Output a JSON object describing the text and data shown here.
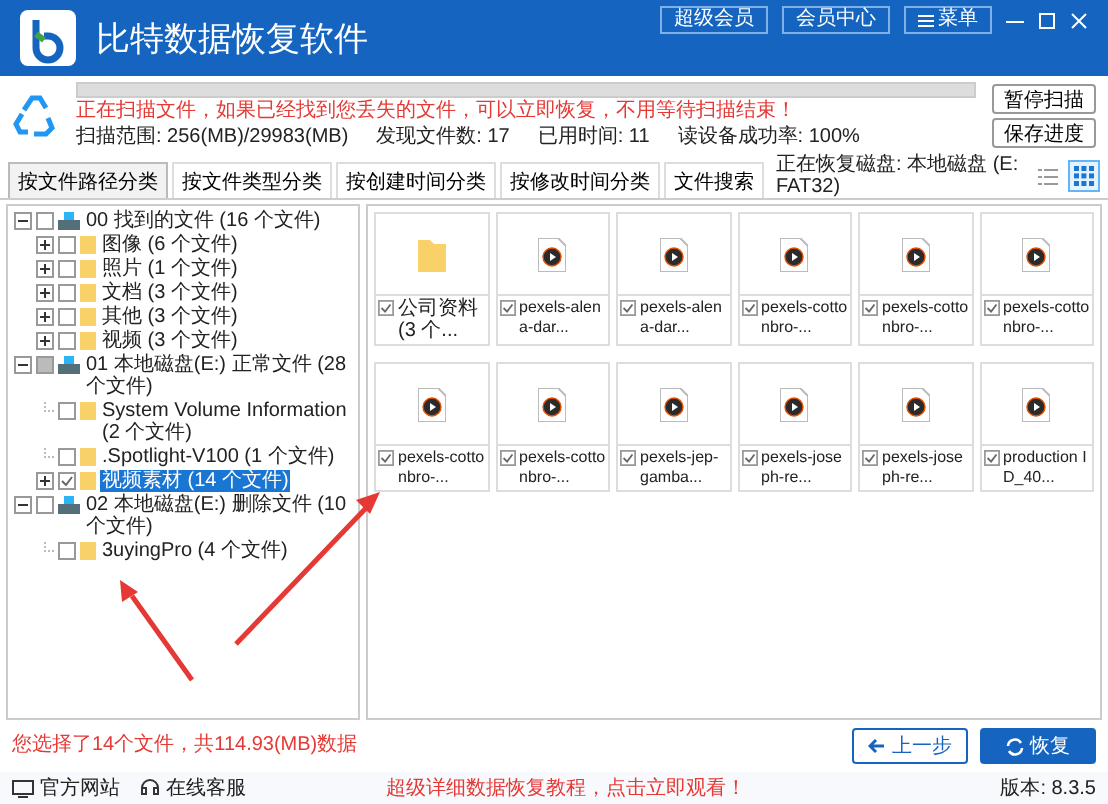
{
  "header": {
    "title": "比特数据恢复软件",
    "buttons": [
      {
        "label": "超级会员",
        "kind": "plain"
      },
      {
        "label": "会员中心",
        "kind": "plain"
      },
      {
        "label": "菜单",
        "kind": "menu"
      }
    ]
  },
  "scan": {
    "level": 0,
    "message": "正在扫描文件，如果已经找到您丢失的文件，可以立即恢复，不用等待扫描结束！",
    "stats": [
      "扫描范围: 256(MB)/29983(MB)",
      "发现文件数: 17",
      "已用时间: 11",
      "读设备成功率: 100%"
    ],
    "buttons": [
      "暂停扫描",
      "保存进度"
    ]
  },
  "tabs": [
    {
      "label": "按文件路径分类",
      "selected": true
    },
    {
      "label": "按文件类型分类",
      "selected": false
    },
    {
      "label": "按创建时间分类",
      "selected": false
    },
    {
      "label": "按修改时间分类",
      "selected": false
    },
    {
      "label": "文件搜索",
      "selected": false
    }
  ],
  "disk": "正在恢复磁盘: 本地磁盘 (E: FAT32)",
  "views": [
    {
      "kind": "list",
      "selected": false
    },
    {
      "kind": "grid",
      "selected": true
    }
  ],
  "tree": [
    {
      "name": "00 找到的文件",
      "count": "(16 个文件)",
      "checked": false,
      "partial": false,
      "expanded": true,
      "selected": false,
      "children": [
        {
          "name": "图像",
          "count": "(6 个文件)",
          "checked": false,
          "expandable": true,
          "selected": false
        },
        {
          "name": "照片",
          "count": "(1 个文件)",
          "checked": false,
          "expandable": true,
          "selected": false
        },
        {
          "name": "文档",
          "count": "(3 个文件)",
          "checked": false,
          "expandable": true,
          "selected": false
        },
        {
          "name": "其他",
          "count": "(3 个文件)",
          "checked": false,
          "expandable": true,
          "selected": false
        },
        {
          "name": "视频",
          "count": "(3 个文件)",
          "checked": false,
          "expandable": true,
          "selected": false
        }
      ]
    },
    {
      "name": "01 本地磁盘(E:) 正常文件",
      "count": "(28 个文件)",
      "checked": false,
      "partial": true,
      "expanded": true,
      "selected": false,
      "children": [
        {
          "name": "System Volume Information",
          "count": "(2 个文件)",
          "checked": false,
          "expandable": false,
          "selected": false
        },
        {
          "name": ".Spotlight-V100",
          "count": "(1 个文件)",
          "checked": false,
          "expandable": false,
          "selected": false
        },
        {
          "name": "视频素材",
          "count": "(14 个文件)",
          "checked": true,
          "expandable": true,
          "selected": true
        }
      ]
    },
    {
      "name": "02 本地磁盘(E:) 删除文件",
      "count": "(10 个文件)",
      "checked": false,
      "partial": false,
      "expanded": true,
      "selected": false,
      "children": [
        {
          "name": "3uyingPro",
          "count": "(4 个文件)",
          "checked": false,
          "expandable": false,
          "selected": false
        }
      ]
    }
  ],
  "files": [
    {
      "kind": "folder",
      "label": "公司资料 (3 个...",
      "checked": true
    },
    {
      "kind": "video",
      "label": "pexels-alena-dar...",
      "checked": true
    },
    {
      "kind": "video",
      "label": "pexels-alena-dar...",
      "checked": true
    },
    {
      "kind": "video",
      "label": "pexels-cottonbro-...",
      "checked": true
    },
    {
      "kind": "video",
      "label": "pexels-cottonbro-...",
      "checked": true
    },
    {
      "kind": "video",
      "label": "pexels-cottonbro-...",
      "checked": true
    },
    {
      "kind": "video",
      "label": "pexels-cottonbro-...",
      "checked": true
    },
    {
      "kind": "video",
      "label": "pexels-cottonbro-...",
      "checked": true
    },
    {
      "kind": "video",
      "label": "pexels-jep-gamba...",
      "checked": true
    },
    {
      "kind": "video",
      "label": "pexels-joseph-re...",
      "checked": true
    },
    {
      "kind": "video",
      "label": "pexels-joseph-re...",
      "checked": true
    },
    {
      "kind": "video",
      "label": "production ID_40...",
      "checked": true
    }
  ],
  "selection": "您选择了14个文件，共114.93(MB)数据",
  "actions": [
    {
      "label": "上一步",
      "kind": "back"
    },
    {
      "label": "恢复",
      "kind": "recover"
    }
  ],
  "footer": {
    "links": [
      {
        "label": "官方网站",
        "kind": "site"
      },
      {
        "label": "在线客服",
        "kind": "service"
      }
    ],
    "promo": "超级详细数据恢复教程，点击立即观看！",
    "version": "版本: 8.3.5"
  }
}
